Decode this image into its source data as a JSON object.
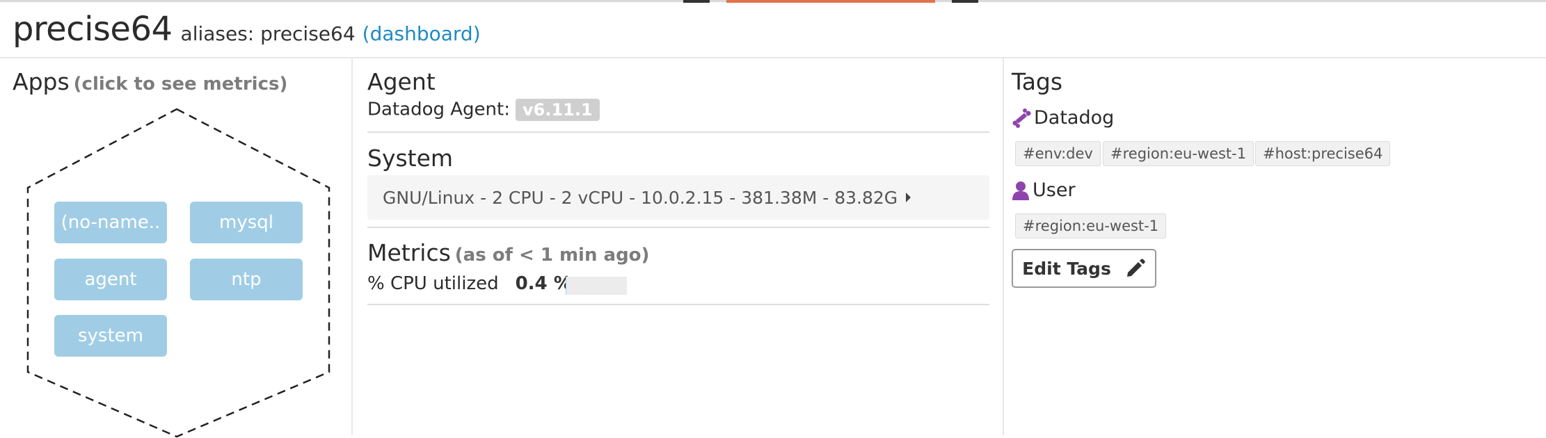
{
  "header": {
    "hostname": "precise64",
    "aliases_label": "aliases: precise64",
    "dashboard_link": "(dashboard)"
  },
  "apps": {
    "title": "Apps",
    "subtitle": "(click to see metrics)",
    "items": [
      "(no-name..",
      "mysql",
      "agent",
      "ntp",
      "system"
    ]
  },
  "agent": {
    "title": "Agent",
    "label": "Datadog Agent:",
    "version": "v6.11.1"
  },
  "system": {
    "title": "System",
    "summary": "GNU/Linux - 2 CPU - 2 vCPU - 10.0.2.15 - 381.38M - 83.82G"
  },
  "metrics": {
    "title": "Metrics",
    "subtitle": "(as of < 1 min ago)",
    "cpu_label": "% CPU utilized",
    "cpu_value": "0.4 %",
    "cpu_fraction": 0.004
  },
  "tags": {
    "title": "Tags",
    "datadog_label": "Datadog",
    "datadog_tags": [
      "#env:dev",
      "#region:eu-west-1",
      "#host:precise64"
    ],
    "user_label": "User",
    "user_tags": [
      "#region:eu-west-1"
    ],
    "edit_label": "Edit Tags"
  },
  "icons": {
    "datadog": "bone-icon",
    "user": "user-icon",
    "edit": "pencil-icon",
    "expand": "caret-right-icon"
  },
  "colors": {
    "accent_link": "#1f8ac4",
    "app_button": "#a0cde5",
    "tag_icon_purple": "#8e44ad",
    "top_accent": "#e0734b"
  }
}
